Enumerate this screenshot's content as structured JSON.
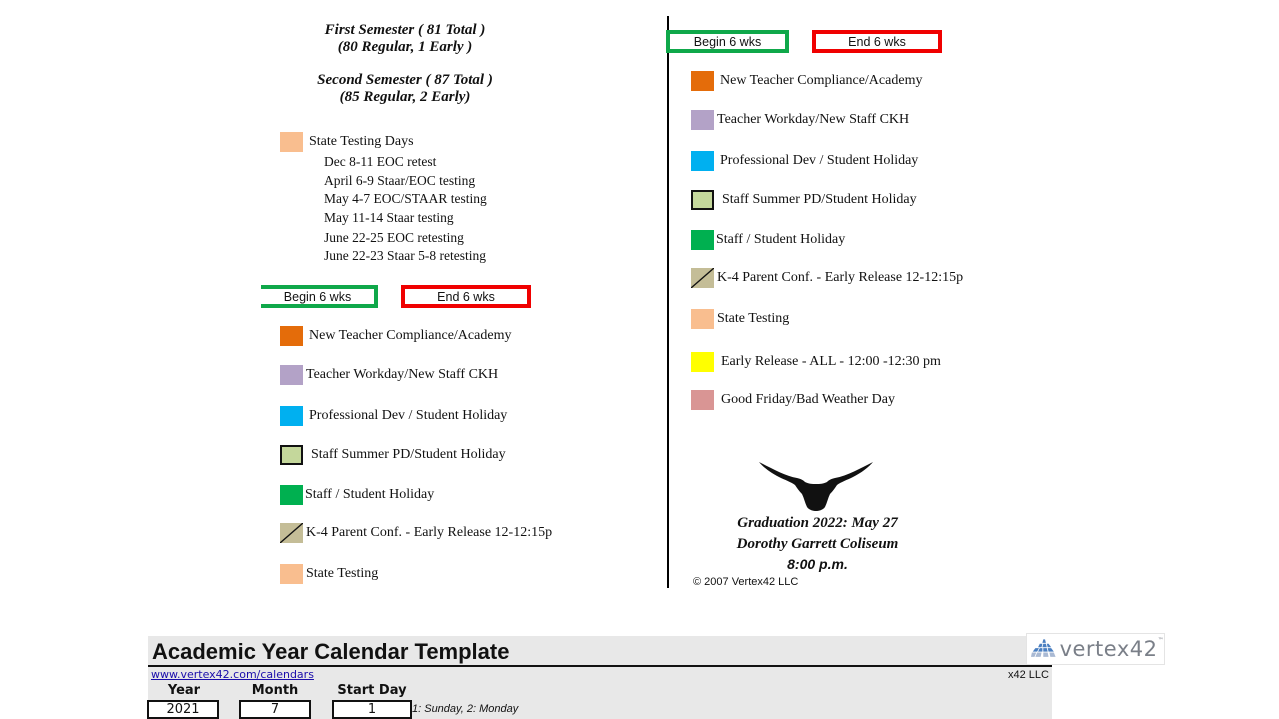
{
  "semesters": {
    "first_title": "First Semester ( 81 Total )",
    "first_detail": "(80 Regular, 1 Early )",
    "second_title": "Second Semester ( 87 Total )",
    "second_detail": "(85 Regular, 2 Early)"
  },
  "state_testing_days": {
    "label": "State Testing Days",
    "color": "#f9be8f",
    "entries": [
      "Dec 8-11  EOC retest",
      "April 6-9  Staar/EOC testing",
      "May 4-7  EOC/STAAR testing",
      "May 11-14  Staar testing",
      "June 22-25  EOC retesting",
      "June 22-23  Staar 5-8 retesting"
    ]
  },
  "six_weeks": {
    "begin_label": "Begin 6 wks",
    "end_label": "End 6 wks",
    "begin_color": "#0fa84a",
    "end_color": "#f00000"
  },
  "legend_left": [
    {
      "label": "New Teacher Compliance/Academy",
      "color": "#e46c0a",
      "style": "solid"
    },
    {
      "label": "Teacher Workday/New Staff CKH",
      "color": "#b3a2c7",
      "style": "solid"
    },
    {
      "label": "Professional Dev / Student Holiday",
      "color": "#00b0f0",
      "style": "solid"
    },
    {
      "label": "Staff Summer PD/Student Holiday",
      "color": "#c4d79b",
      "style": "bordered"
    },
    {
      "label": "Staff / Student Holiday",
      "color": "#00b050",
      "style": "solid"
    },
    {
      "label": "K-4 Parent Conf. - Early Release 12-12:15p",
      "color": "#c4bd97",
      "style": "slash"
    },
    {
      "label": "State Testing",
      "color": "#f9be8f",
      "style": "solid"
    }
  ],
  "legend_right": [
    {
      "label": "New Teacher Compliance/Academy",
      "color": "#e46c0a",
      "style": "solid"
    },
    {
      "label": "Teacher Workday/New Staff CKH",
      "color": "#b3a2c7",
      "style": "solid"
    },
    {
      "label": "Professional Dev / Student Holiday",
      "color": "#00b0f0",
      "style": "solid"
    },
    {
      "label": "Staff Summer PD/Student Holiday",
      "color": "#c4d79b",
      "style": "bordered"
    },
    {
      "label": "Staff / Student Holiday",
      "color": "#00b050",
      "style": "solid"
    },
    {
      "label": "K-4 Parent Conf. - Early Release 12-12:15p",
      "color": "#c4bd97",
      "style": "slash"
    },
    {
      "label": "State Testing",
      "color": "#f9be8f",
      "style": "solid"
    },
    {
      "label": "Early Release - ALL - 12:00 -12:30 pm",
      "color": "#ffff00",
      "style": "solid"
    },
    {
      "label": "Good Friday/Bad Weather Day",
      "color": "#d99594",
      "style": "solid"
    }
  ],
  "graduation": {
    "icon": "longhorn-icon",
    "line1": "Graduation 2022: May 27",
    "line2": "Dorothy Garrett Coliseum",
    "time": "8:00 p.m."
  },
  "copyright": "© 2007 Vertex42 LLC",
  "banner": {
    "title": "Academic Year Calendar Template",
    "link": "www.vertex42.com/calendars",
    "llc": "x42 LLC",
    "logo_text": "vertex42",
    "logo_tm": "™",
    "fields": [
      {
        "label": "Year",
        "value": "2021"
      },
      {
        "label": "Month",
        "value": "7"
      },
      {
        "label": "Start Day",
        "value": "1"
      }
    ],
    "start_day_hint": "1: Sunday, 2: Monday"
  }
}
